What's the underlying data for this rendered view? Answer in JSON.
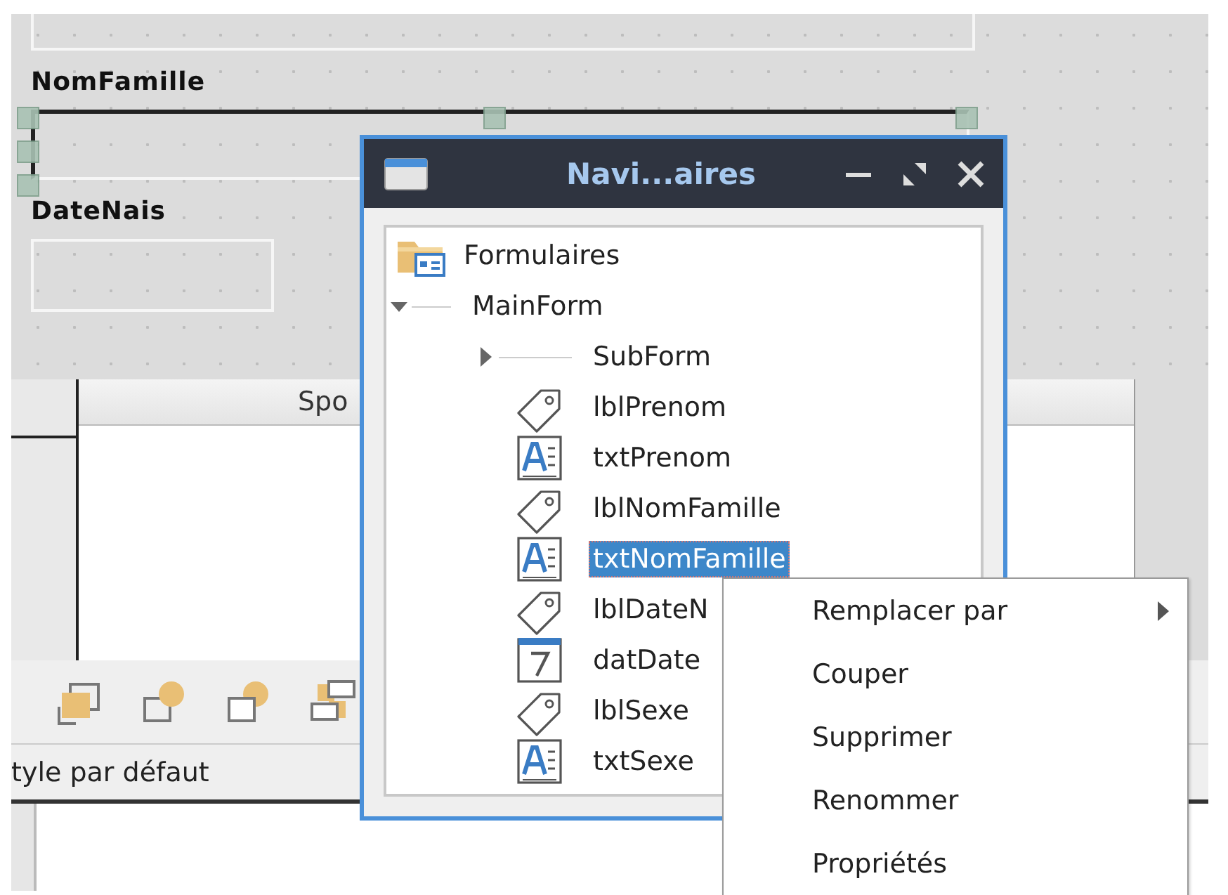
{
  "designer": {
    "fields": [
      {
        "label": "NomFamille",
        "kind": "text",
        "selected": true
      },
      {
        "label": "DateNais",
        "kind": "date",
        "selected": false
      }
    ],
    "table": {
      "column_header": "Spo"
    },
    "status_bar": "tyle par défaut"
  },
  "navigator": {
    "title": "Navi...aires",
    "tree": [
      {
        "label": "Formulaires",
        "kind": "root",
        "selected": false,
        "children": [
          {
            "label": "MainForm",
            "kind": "form",
            "expanded": true,
            "selected": false,
            "children": [
              {
                "label": "SubForm",
                "kind": "form",
                "expanded": false,
                "selected": false
              },
              {
                "label": "lblPrenom",
                "kind": "label",
                "selected": false
              },
              {
                "label": "txtPrenom",
                "kind": "textbox",
                "selected": false
              },
              {
                "label": "lblNomFamille",
                "kind": "label",
                "selected": false
              },
              {
                "label": "txtNomFamille",
                "kind": "textbox",
                "selected": true
              },
              {
                "label": "lblDateN",
                "kind": "label",
                "selected": false
              },
              {
                "label": "datDate",
                "kind": "date",
                "selected": false
              },
              {
                "label": "lblSexe",
                "kind": "label",
                "selected": false
              },
              {
                "label": "txtSexe",
                "kind": "textbox",
                "selected": false
              }
            ]
          }
        ]
      }
    ]
  },
  "context_menu": {
    "items": [
      {
        "label": "Remplacer par",
        "submenu": true
      },
      {
        "label": "Couper",
        "submenu": false
      },
      {
        "label": "Supprimer",
        "submenu": false
      },
      {
        "label": "Renommer",
        "submenu": false
      },
      {
        "label": "Propriétés",
        "submenu": false
      }
    ]
  }
}
